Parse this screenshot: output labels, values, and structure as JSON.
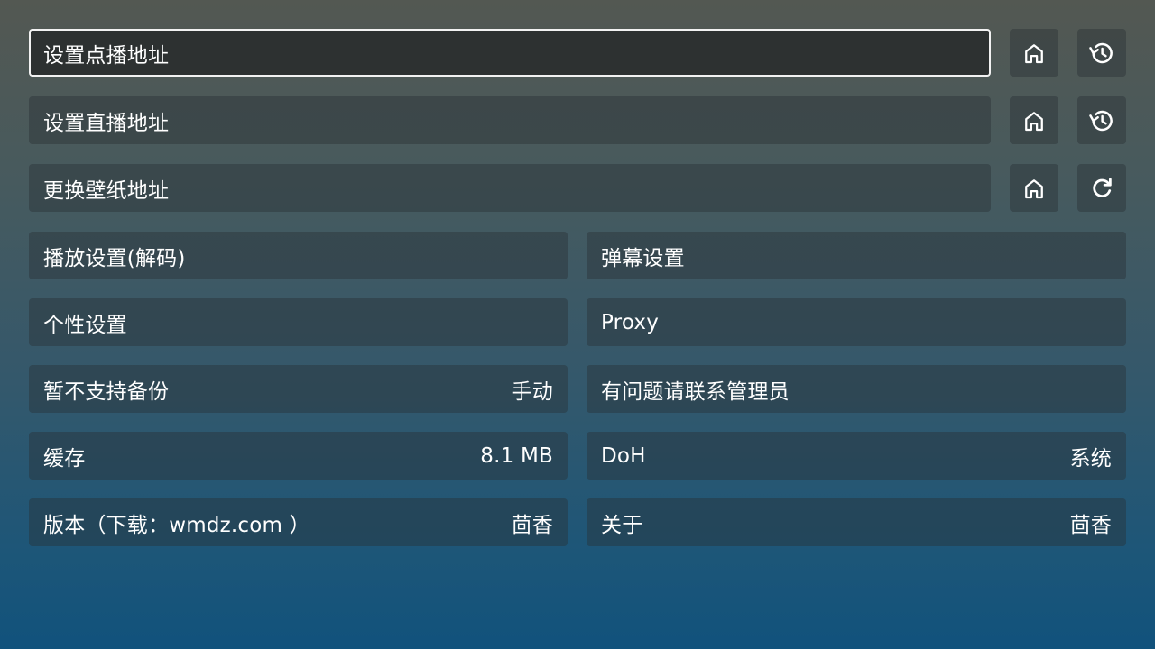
{
  "vod": {
    "label": "设置点播地址",
    "home_icon": "home-icon",
    "history_icon": "history-icon"
  },
  "live": {
    "label": "设置直播地址",
    "home_icon": "home-icon",
    "history_icon": "history-icon"
  },
  "wallpaper": {
    "label": "更换壁纸地址",
    "home_icon": "home-icon",
    "refresh_icon": "refresh-icon"
  },
  "settings": {
    "player": {
      "label": "播放设置(解码)"
    },
    "danmaku": {
      "label": "弹幕设置"
    },
    "personal": {
      "label": "个性设置"
    },
    "proxy": {
      "label": "Proxy"
    },
    "backup": {
      "label": "暂不支持备份",
      "value": "手动"
    },
    "contact": {
      "label": "有问题请联系管理员"
    },
    "cache": {
      "label": "缓存",
      "value": "8.1 MB"
    },
    "doh": {
      "label": "DoH",
      "value": "系统"
    },
    "version": {
      "label": "版本（下载：wmdz.com ）",
      "value": "茴香"
    },
    "about": {
      "label": "关于",
      "value": "茴香"
    }
  },
  "colors": {
    "focus_border": "#f2f2f2",
    "focus_bg": "#2d3131"
  }
}
